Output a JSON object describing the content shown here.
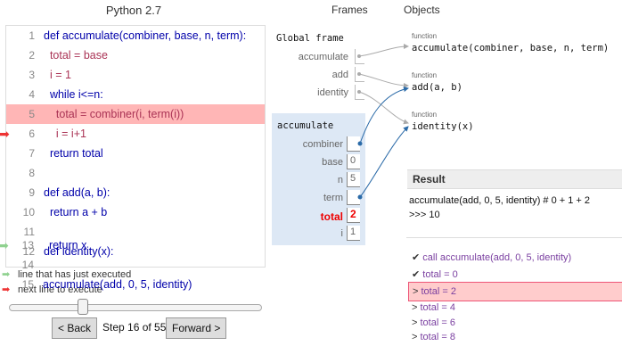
{
  "code_panel": {
    "language": "Python 2.7",
    "lines": [
      {
        "n": "1",
        "code": "def accumulate(combiner, base, n, term):"
      },
      {
        "n": "2",
        "code": "  total = base"
      },
      {
        "n": "3",
        "code": "  i = 1"
      },
      {
        "n": "4",
        "code": "  while i<=n:"
      },
      {
        "n": "5",
        "code": "    total = combiner(i, term(i))"
      },
      {
        "n": "6",
        "code": "    i = i+1"
      },
      {
        "n": "7",
        "code": "  return total"
      },
      {
        "n": "8",
        "code": ""
      },
      {
        "n": "9",
        "code": "def add(a, b):"
      },
      {
        "n": "10",
        "code": "  return a + b"
      },
      {
        "n": "11",
        "code": ""
      },
      {
        "n": "12",
        "code": "def identity(x):"
      },
      {
        "n": "13",
        "code": "  return x"
      },
      {
        "n": "14",
        "code": ""
      },
      {
        "n": "15",
        "code": "accumulate(add, 0, 5, identity)"
      }
    ],
    "legend_just_executed": "line that has just executed",
    "legend_next": "next line to execute"
  },
  "nav": {
    "back_label": "< Back",
    "step_text": "Step 16 of 55",
    "forward_label": "Forward >",
    "progress_fraction": 0.29
  },
  "frames": {
    "frames_header": "Frames",
    "objects_header": "Objects",
    "global_title": "Global frame",
    "global_vars": [
      "accumulate",
      "add",
      "identity"
    ],
    "acc_title": "accumulate",
    "acc_vars": [
      {
        "name": "combiner",
        "value": ""
      },
      {
        "name": "base",
        "value": "0"
      },
      {
        "name": "n",
        "value": "5"
      },
      {
        "name": "term",
        "value": ""
      },
      {
        "name": "total",
        "value": "2"
      },
      {
        "name": "i",
        "value": "1"
      }
    ],
    "objects": [
      {
        "type": "function",
        "sig": "accumulate(combiner, base, n, term)"
      },
      {
        "type": "function",
        "sig": "add(a, b)"
      },
      {
        "type": "function",
        "sig": "identity(x)"
      }
    ]
  },
  "result": {
    "header": "Result",
    "expr": "accumulate(add, 0, 5, identity) # 0 + 1 + 2",
    "output": ">>> 10",
    "trace": [
      {
        "mark": "✔",
        "text": "call accumulate(add, 0, 5, identity)"
      },
      {
        "mark": "✔",
        "text": "total = 0"
      },
      {
        "mark": ">",
        "text": "total = 2"
      },
      {
        "mark": ">",
        "text": "total = 4"
      },
      {
        "mark": ">",
        "text": "total = 6"
      },
      {
        "mark": ">",
        "text": "total = 8"
      }
    ]
  }
}
